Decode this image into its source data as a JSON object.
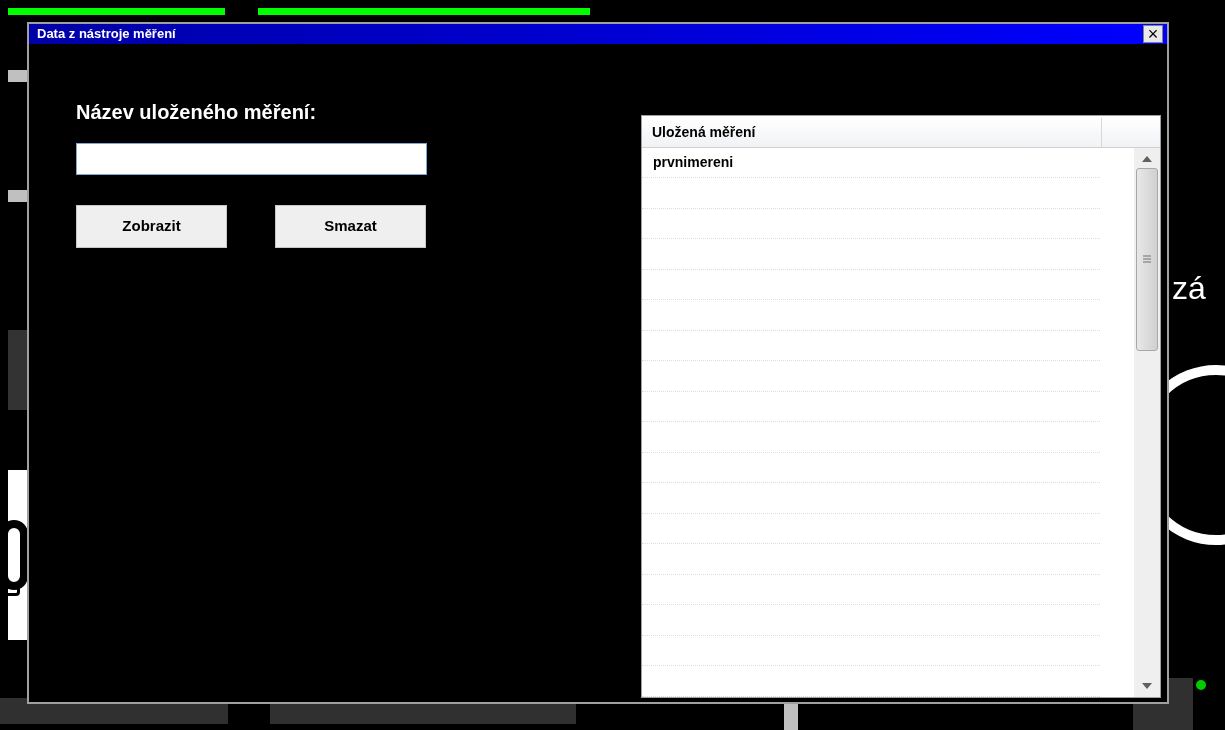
{
  "background": {
    "labels": [
      {
        "text": "zá",
        "kind": "right"
      }
    ]
  },
  "window": {
    "title": "Data z nástroje měření",
    "close": "×"
  },
  "form": {
    "label": "Název uloženého měření:"
  },
  "buttons": [
    "Zobrazit",
    "Smazat"
  ],
  "list": {
    "columns": [
      "Uložená měření"
    ],
    "rows": [
      "prvnimereni"
    ]
  }
}
